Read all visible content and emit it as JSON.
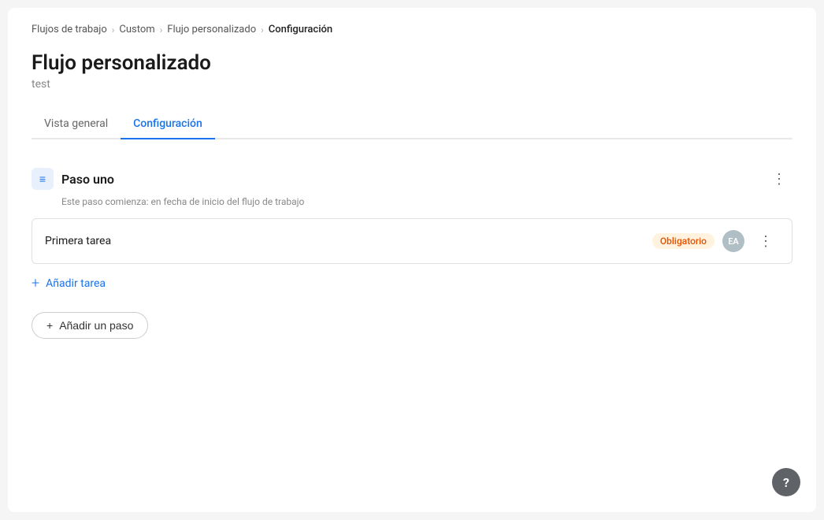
{
  "breadcrumb": {
    "items": [
      {
        "label": "Flujos de trabajo",
        "active": false
      },
      {
        "label": "Custom",
        "active": false
      },
      {
        "label": "Flujo personalizado",
        "active": false
      },
      {
        "label": "Configuración",
        "active": true
      }
    ]
  },
  "page": {
    "title": "Flujo personalizado",
    "subtitle": "test"
  },
  "tabs": [
    {
      "label": "Vista general",
      "active": false
    },
    {
      "label": "Configuración",
      "active": true
    }
  ],
  "step": {
    "icon_symbol": "≡",
    "title": "Paso uno",
    "subtitle": "Este paso comienza: en fecha de inicio del flujo de trabajo",
    "tasks": [
      {
        "name": "Primera tarea",
        "badge": "Obligatorio",
        "avatar": "EA"
      }
    ]
  },
  "actions": {
    "add_task_label": "Añadir tarea",
    "add_step_label": "Añadir un paso"
  },
  "help": {
    "symbol": "?"
  }
}
